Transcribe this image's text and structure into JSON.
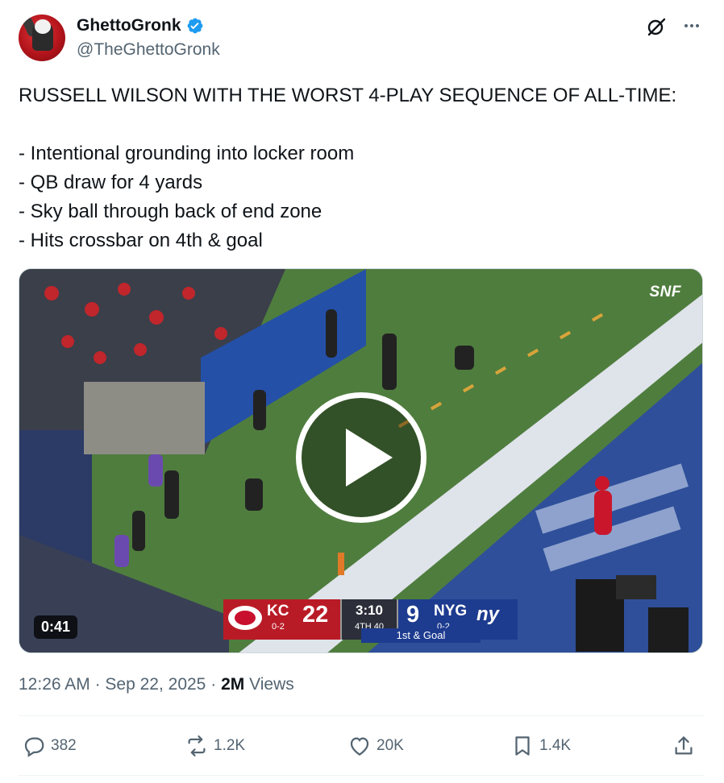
{
  "author": {
    "display_name": "GhettoGronk",
    "handle": "@TheGhettoGronk",
    "verified": true
  },
  "tweet": {
    "lines": [
      "RUSSELL WILSON WITH THE WORST 4-PLAY SEQUENCE OF ALL-TIME:",
      "",
      "- Intentional grounding into locker room",
      "- QB draw for 4 yards",
      "- Sky ball through back of end zone",
      "- Hits crossbar on 4th & goal"
    ]
  },
  "media": {
    "duration": "0:41",
    "network": "SNF",
    "scoreboard": {
      "away_abbr": "KC",
      "away_record": "0-2",
      "away_score": "22",
      "clock": "3:10",
      "quarter": "4TH 40",
      "home_score": "9",
      "home_abbr": "NYG",
      "home_record": "0-2",
      "home_logo_text": "ny",
      "down": "1st & Goal"
    }
  },
  "meta": {
    "time": "12:26 AM",
    "separator": "·",
    "date": "Sep 22, 2025",
    "views_count": "2M",
    "views_label": "Views"
  },
  "actions": {
    "replies": "382",
    "reposts": "1.2K",
    "likes": "20K",
    "bookmarks": "1.4K"
  },
  "colors": {
    "verified_blue": "#1d9bf0",
    "secondary_text": "#536471",
    "primary_text": "#0f1419"
  }
}
